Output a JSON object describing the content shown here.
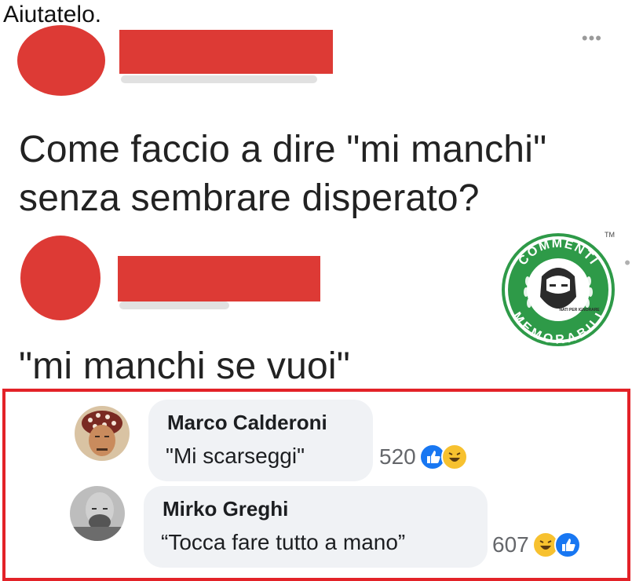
{
  "caption": "Aiutatelo.",
  "post": {
    "question": [
      "Come faccio a dire \"mi manchi\"",
      "senza sembrare disperato?"
    ],
    "answer": "\"mi manchi se vuoi\"",
    "more_icon": "more-dots-icon"
  },
  "logo": {
    "top": "COMMENTI",
    "bottom": "MEMORABILI",
    "tag": "NATI PER IGNORARE",
    "tm": "TM"
  },
  "comments": [
    {
      "author": "Marco Calderoni",
      "text": "\"Mi scarseggi\"",
      "count": "520",
      "reactions": [
        "like",
        "haha"
      ]
    },
    {
      "author": "Mirko Greghi",
      "text": "“Tocca fare tutto a mano”",
      "count": "607",
      "reactions": [
        "haha",
        "like"
      ]
    }
  ],
  "colors": {
    "redact": "#dd3a35",
    "frame": "#e32228",
    "brand_green": "#2e9a48",
    "like_blue": "#1877f2",
    "haha_yellow": "#f7c12f"
  }
}
